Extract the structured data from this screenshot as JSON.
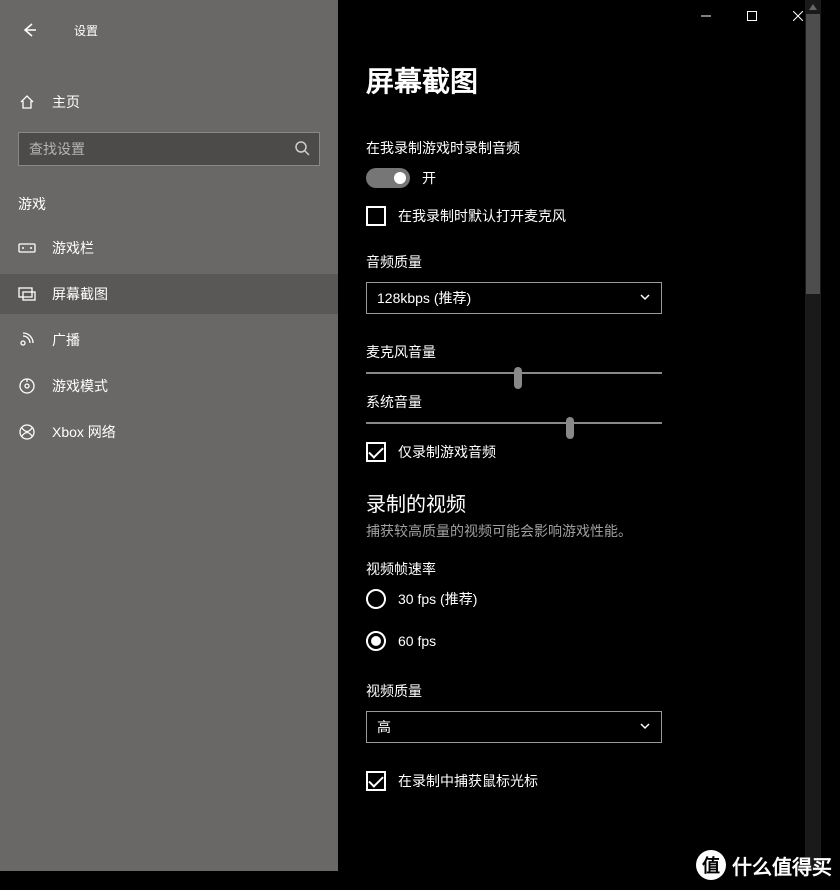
{
  "app_title": "设置",
  "home_label": "主页",
  "search": {
    "placeholder": "查找设置"
  },
  "group_label": "游戏",
  "nav": [
    {
      "label": "游戏栏"
    },
    {
      "label": "屏幕截图"
    },
    {
      "label": "广播"
    },
    {
      "label": "游戏模式"
    },
    {
      "label": "Xbox 网络"
    }
  ],
  "page": {
    "title": "屏幕截图",
    "audio_record_label": "在我录制游戏时录制音频",
    "toggle_on_label": "开",
    "mic_default_label": "在我录制时默认打开麦克风",
    "audio_quality_label": "音频质量",
    "audio_quality_value": "128kbps (推荐)",
    "mic_volume_label": "麦克风音量",
    "sys_volume_label": "系统音量",
    "game_audio_only": "仅录制游戏音频",
    "recorded_video_title": "录制的视频",
    "recorded_video_desc": "捕获较高质量的视频可能会影响游戏性能。",
    "framerate_label": "视频帧速率",
    "fps30": "30 fps (推荐)",
    "fps60": "60 fps",
    "video_quality_label": "视频质量",
    "video_quality_value": "高",
    "capture_cursor": "在录制中捕获鼠标光标"
  },
  "watermark": "什么值得买",
  "watermark_badge": "值"
}
